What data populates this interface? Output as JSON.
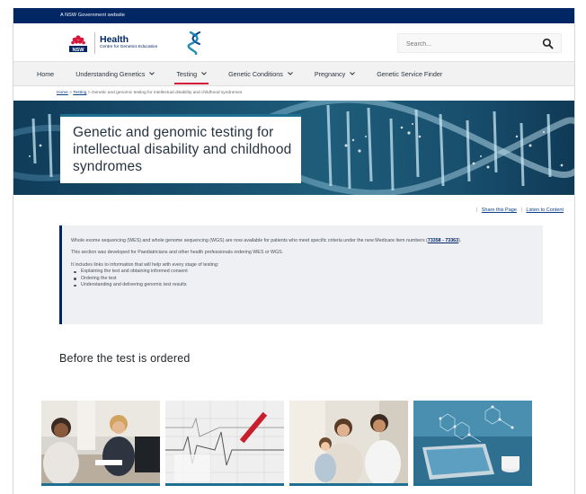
{
  "gov_bar": {
    "text": "A NSW Government website"
  },
  "header": {
    "logo_nsw": "NSW",
    "logo_title": "Health",
    "logo_subtitle": "Centre for Genetics Education",
    "search_placeholder": "Search..."
  },
  "nav": {
    "items": [
      {
        "label": "Home",
        "has_dropdown": false
      },
      {
        "label": "Understanding Genetics",
        "has_dropdown": true
      },
      {
        "label": "Testing",
        "has_dropdown": true,
        "active": true
      },
      {
        "label": "Genetic Conditions",
        "has_dropdown": true
      },
      {
        "label": "Pregnancy",
        "has_dropdown": true
      },
      {
        "label": "Genetic Service Finder",
        "has_dropdown": false
      }
    ]
  },
  "breadcrumb": {
    "home": "Home",
    "sep": ">",
    "testing": "Testing",
    "current": "Genetic and genomic testing for intellectual disability and childhood syndromes"
  },
  "hero": {
    "title": "Genetic and genomic testing for intellectual disability and childhood syndromes"
  },
  "share": {
    "share_label": "Share this Page",
    "sep": "|",
    "listen_label": "Listen to Content"
  },
  "callout": {
    "p1_before": "Whole exome sequencing (WES) and whole genome sequencing (WGS) are now available for patients who meet specific criteria under the new Medicare item numbers (",
    "item1": "73358",
    "dash": " - ",
    "item2": "73363",
    "p1_after": ").",
    "p2": "This section was developed for Paediatricians and other health professionals ordering WES or WGS.",
    "p3": "It includes links to information that will help with every stage of testing:",
    "list": [
      "Explaining the test and obtaining informed consent",
      "Ordering the test",
      "Understanding and delivering genomic test results"
    ]
  },
  "section": {
    "title": "Before the test is ordered"
  },
  "colors": {
    "gov_bar": "#002664",
    "accent_red": "#d7153a",
    "accent_teal": "#1e6f92",
    "link": "#0a3e86",
    "callout_bg": "#eef0f4"
  },
  "icons": [
    "nsw-waratah-logo",
    "dna-helix-icon",
    "search-icon",
    "chevron-down-icon"
  ]
}
